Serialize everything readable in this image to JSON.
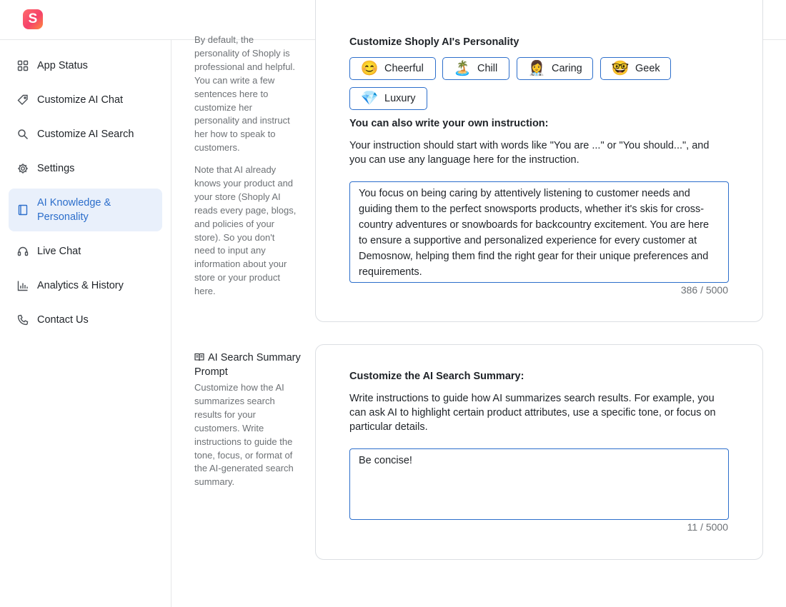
{
  "app": {
    "logo_letter": "S",
    "brand_gradient": [
      "#ff6b6b",
      "#f5426b",
      "#ff8a3d"
    ]
  },
  "colors": {
    "accent": "#2c6ecb",
    "active_bg": "#e9f0fb",
    "muted_text": "#6d7175"
  },
  "sidebar": {
    "items": [
      {
        "label": "App Status",
        "icon": "grid-icon"
      },
      {
        "label": "Customize AI Chat",
        "icon": "tag-icon"
      },
      {
        "label": "Customize AI Search",
        "icon": "search-icon"
      },
      {
        "label": "Settings",
        "icon": "gear-icon"
      },
      {
        "label": "AI Knowledge & Personality",
        "icon": "book-icon",
        "active": true
      },
      {
        "label": "Live Chat",
        "icon": "headset-icon"
      },
      {
        "label": "Analytics & History",
        "icon": "bar-chart-icon"
      },
      {
        "label": "Contact Us",
        "icon": "phone-icon"
      }
    ]
  },
  "personality_section": {
    "description_lines": [
      "By default, the",
      "personality of Shoply is",
      "professional and helpful.",
      "You can write a few",
      "sentences here to",
      "customize her",
      "personality and instruct",
      "her how to speak to",
      "customers."
    ],
    "note_lines": [
      "Note that AI already",
      "knows your product and",
      "your store (Shoply AI",
      "reads every page, blogs,",
      "and policies of your",
      "store). So you don't",
      "need to input any",
      "information about your",
      "store or your product",
      "here."
    ],
    "card": {
      "heading": "Customize Shoply AI's Personality",
      "personalities": [
        {
          "label": "Cheerful",
          "emoji": "😊",
          "icon": "cheerful-emoji-icon"
        },
        {
          "label": "Chill",
          "emoji": "🏝️",
          "icon": "island-icon"
        },
        {
          "label": "Caring",
          "emoji": "👩‍⚕️",
          "icon": "nurse-icon"
        },
        {
          "label": "Geek",
          "emoji": "🤓",
          "icon": "nerd-face-icon"
        },
        {
          "label": "Luxury",
          "emoji": "💎",
          "icon": "diamond-icon"
        }
      ],
      "own_instruction_heading": "You can also write your own instruction:",
      "instruction_help_lines": [
        "Your instruction should start with words like \"You are ...\" or \"You should...\", and",
        "you can use any language here for the instruction."
      ],
      "instruction_value_lines": [
        "You focus on being caring by attentively listening to customer needs and",
        "guiding them to the perfect snowsports products, whether it's skis for cross-",
        "country adventures or snowboards for backcountry excitement. You are here",
        "to ensure a supportive and personalized experience for every customer at",
        "Demosnow, helping them find the right gear for their unique preferences and",
        "requirements."
      ],
      "counter": "386 / 5000"
    }
  },
  "search_section": {
    "title": "AI Search Summary Prompt",
    "title_icon": "book-open-icon",
    "title_lines": [
      "AI Search Summary",
      "Prompt"
    ],
    "description_lines": [
      "Customize how the AI",
      "summarizes search",
      "results for your",
      "customers. Write",
      "instructions to guide the",
      "tone, focus, or format of",
      "the AI-generated search",
      "summary."
    ],
    "card": {
      "heading": "Customize the AI Search Summary:",
      "help_lines": [
        "Write instructions to guide how AI summarizes search results. For example, you",
        "can ask AI to highlight certain product attributes, use a specific tone, or focus on",
        "particular details."
      ],
      "value": "Be concise!",
      "counter": "11 / 5000"
    }
  }
}
